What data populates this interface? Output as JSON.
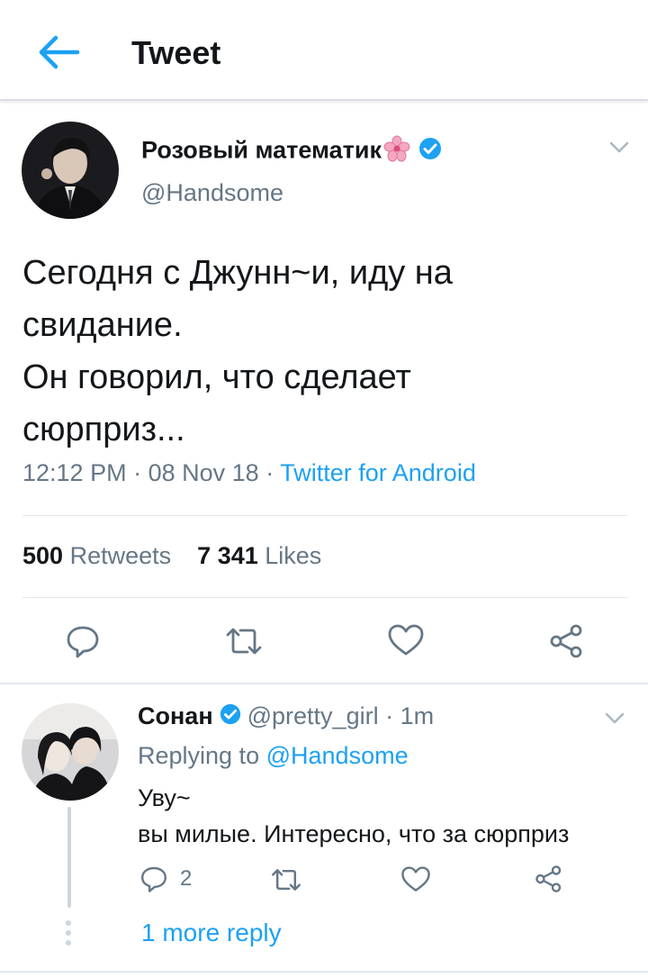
{
  "header": {
    "title": "Tweet",
    "back_icon": "arrow-left-icon"
  },
  "tweet": {
    "author_name": "Розовый математик",
    "author_emoji": "cherry-blossom-icon",
    "verified_icon": "verified-badge-icon",
    "handle": "@Handsome",
    "text_lines": [
      "Сегодня с Джунн~и, иду на",
      "свидание.",
      "Он говорил, что сделает",
      "сюрприз..."
    ],
    "time": "12:12 PM",
    "date": "08 Nov 18",
    "separator": "·",
    "source": "Twitter for Android",
    "retweets_count": "500",
    "retweets_label": "Retweets",
    "likes_count": "7 341",
    "likes_label": "Likes",
    "actions": [
      "reply-icon",
      "retweet-icon",
      "like-icon",
      "share-icon"
    ]
  },
  "reply": {
    "author_name": "Сонан",
    "handle": "@pretty_girl",
    "time": "1m",
    "separator": "·",
    "replying_prefix": "Replying to",
    "replying_mention": "@Handsome",
    "text_lines": [
      "Уву~",
      "вы милые. Интересно, что за сюрприз"
    ],
    "reply_count": "2",
    "more_replies": "1 more reply"
  },
  "colors": {
    "accent": "#1da1f2",
    "muted": "#657786",
    "text": "#14171a",
    "divider": "#e1e8ed",
    "icon": "#657786"
  }
}
